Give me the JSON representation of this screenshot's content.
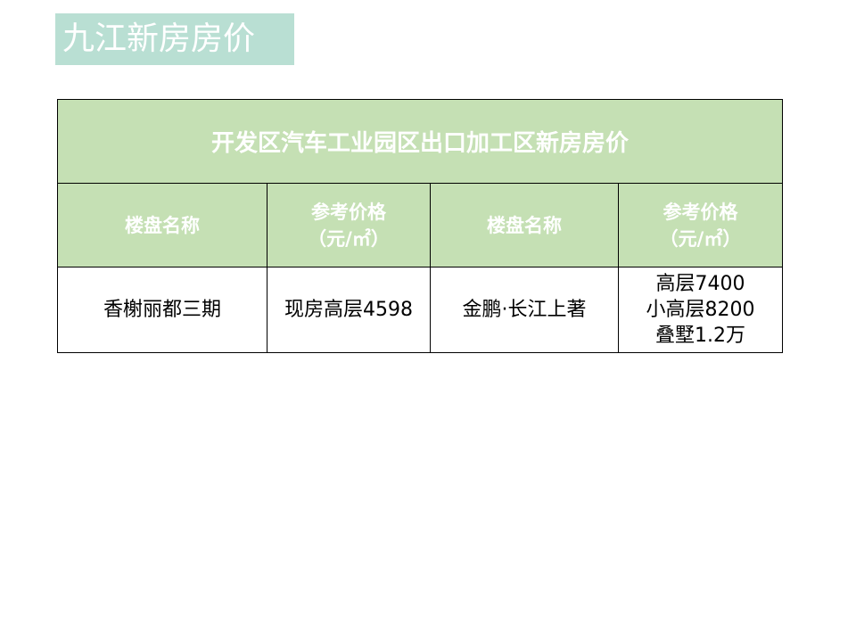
{
  "page": {
    "title": "九江新房房价"
  },
  "table": {
    "caption": "开发区汽车工业园区出口加工区新房房价",
    "headers": [
      {
        "lines": [
          "楼盘名称"
        ]
      },
      {
        "lines": [
          "参考价格",
          "（元/㎡）"
        ]
      },
      {
        "lines": [
          "楼盘名称"
        ]
      },
      {
        "lines": [
          "参考价格",
          "（元/㎡）"
        ]
      }
    ],
    "rows": [
      {
        "cells": [
          {
            "lines": [
              "香榭丽都三期"
            ]
          },
          {
            "lines": [
              "现房高层4598"
            ]
          },
          {
            "lines": [
              "金鹏·长江上著"
            ]
          },
          {
            "lines": [
              "高层7400",
              "小高层8200",
              "叠墅1.2万"
            ]
          }
        ]
      }
    ]
  },
  "colors": {
    "title_bg": "#b9dfd3",
    "table_header_bg": "#c5e0b4",
    "header_text": "#ffffff",
    "body_text": "#000000"
  }
}
